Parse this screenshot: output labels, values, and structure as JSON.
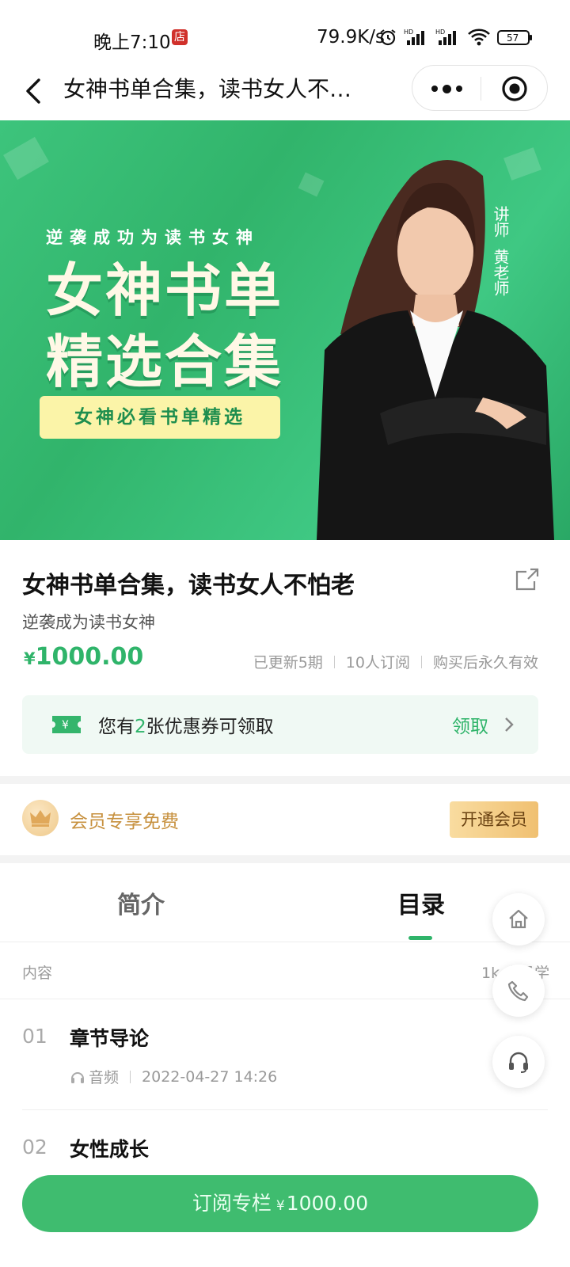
{
  "status_bar": {
    "time": "晚上7:10",
    "badge": "店",
    "speed": "79.9K/s",
    "battery": "57"
  },
  "nav": {
    "title": "女神书单合集，读书女人不…"
  },
  "banner": {
    "subline": "逆袭成功为读书女神",
    "headline_1": "女神书单",
    "headline_2": "精选合集",
    "pill": "女神必看书单精选",
    "teacher_label": "讲师",
    "teacher_name": "黄老师"
  },
  "course": {
    "title": "女神书单合集，读书女人不怕老",
    "subtitle": "逆袭成为读书女神",
    "price_currency": "¥",
    "price_value": "1000.00",
    "meta": [
      "已更新5期",
      "10人订阅",
      "购买后永久有效"
    ]
  },
  "coupon": {
    "text_prefix": "您有",
    "count": "2",
    "text_suffix": "张优惠券可领取",
    "action": "领取"
  },
  "member": {
    "text": "会员专享免费",
    "button": "开通会员"
  },
  "tabs": [
    {
      "label": "简介",
      "active": false
    },
    {
      "label": "目录",
      "active": true
    }
  ],
  "catalog": {
    "header_left": "内容",
    "header_right": "1k 人已学",
    "items": [
      {
        "index": "01",
        "title": "章节导论",
        "type": "音频",
        "date": "2022-04-27 14:26"
      },
      {
        "index": "02",
        "title": "女性成长"
      }
    ]
  },
  "floating": [
    "home-icon",
    "phone-icon",
    "headset-icon"
  ],
  "bottom": {
    "button_prefix": "订阅专栏",
    "button_currency": "¥",
    "button_price": "1000.00"
  },
  "colors": {
    "brand_green": "#2fb46a",
    "gold": "#c7913f"
  }
}
